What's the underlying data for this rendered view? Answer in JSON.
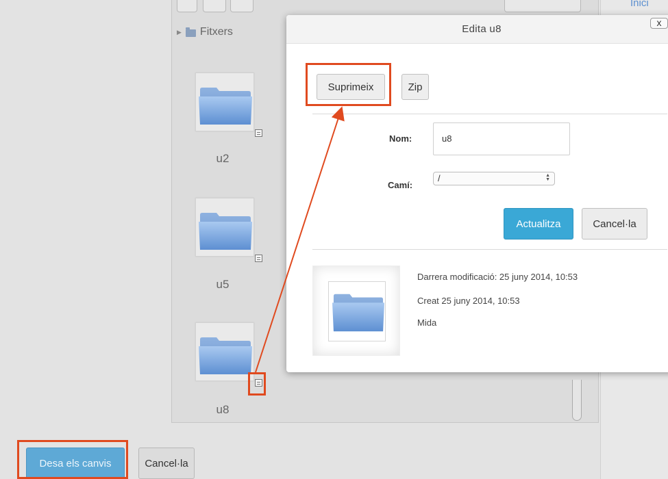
{
  "background": {
    "breadcrumb": "Fitxers",
    "top_link": "Inici",
    "folders": [
      {
        "name": "u2"
      },
      {
        "name": "u5"
      },
      {
        "name": "u8"
      }
    ],
    "save_label": "Desa els canvis",
    "cancel_label": "Cancel·la"
  },
  "dialog": {
    "title": "Edita u8",
    "close_label": "x",
    "delete_label": "Suprimeix",
    "zip_label": "Zip",
    "name_label": "Nom:",
    "name_value": "u8",
    "path_label": "Camí:",
    "path_value": "/",
    "update_label": "Actualitza",
    "cancel_label": "Cancel·la",
    "modified_text": "Darrera modificació: 25 juny 2014, 10:53",
    "created_text": "Creat 25 juny 2014, 10:53",
    "size_text": "Mida"
  },
  "colors": {
    "highlight": "#e04a1f",
    "primary_button": "#3aa8d6",
    "folder_icon": "#6fa0de"
  }
}
